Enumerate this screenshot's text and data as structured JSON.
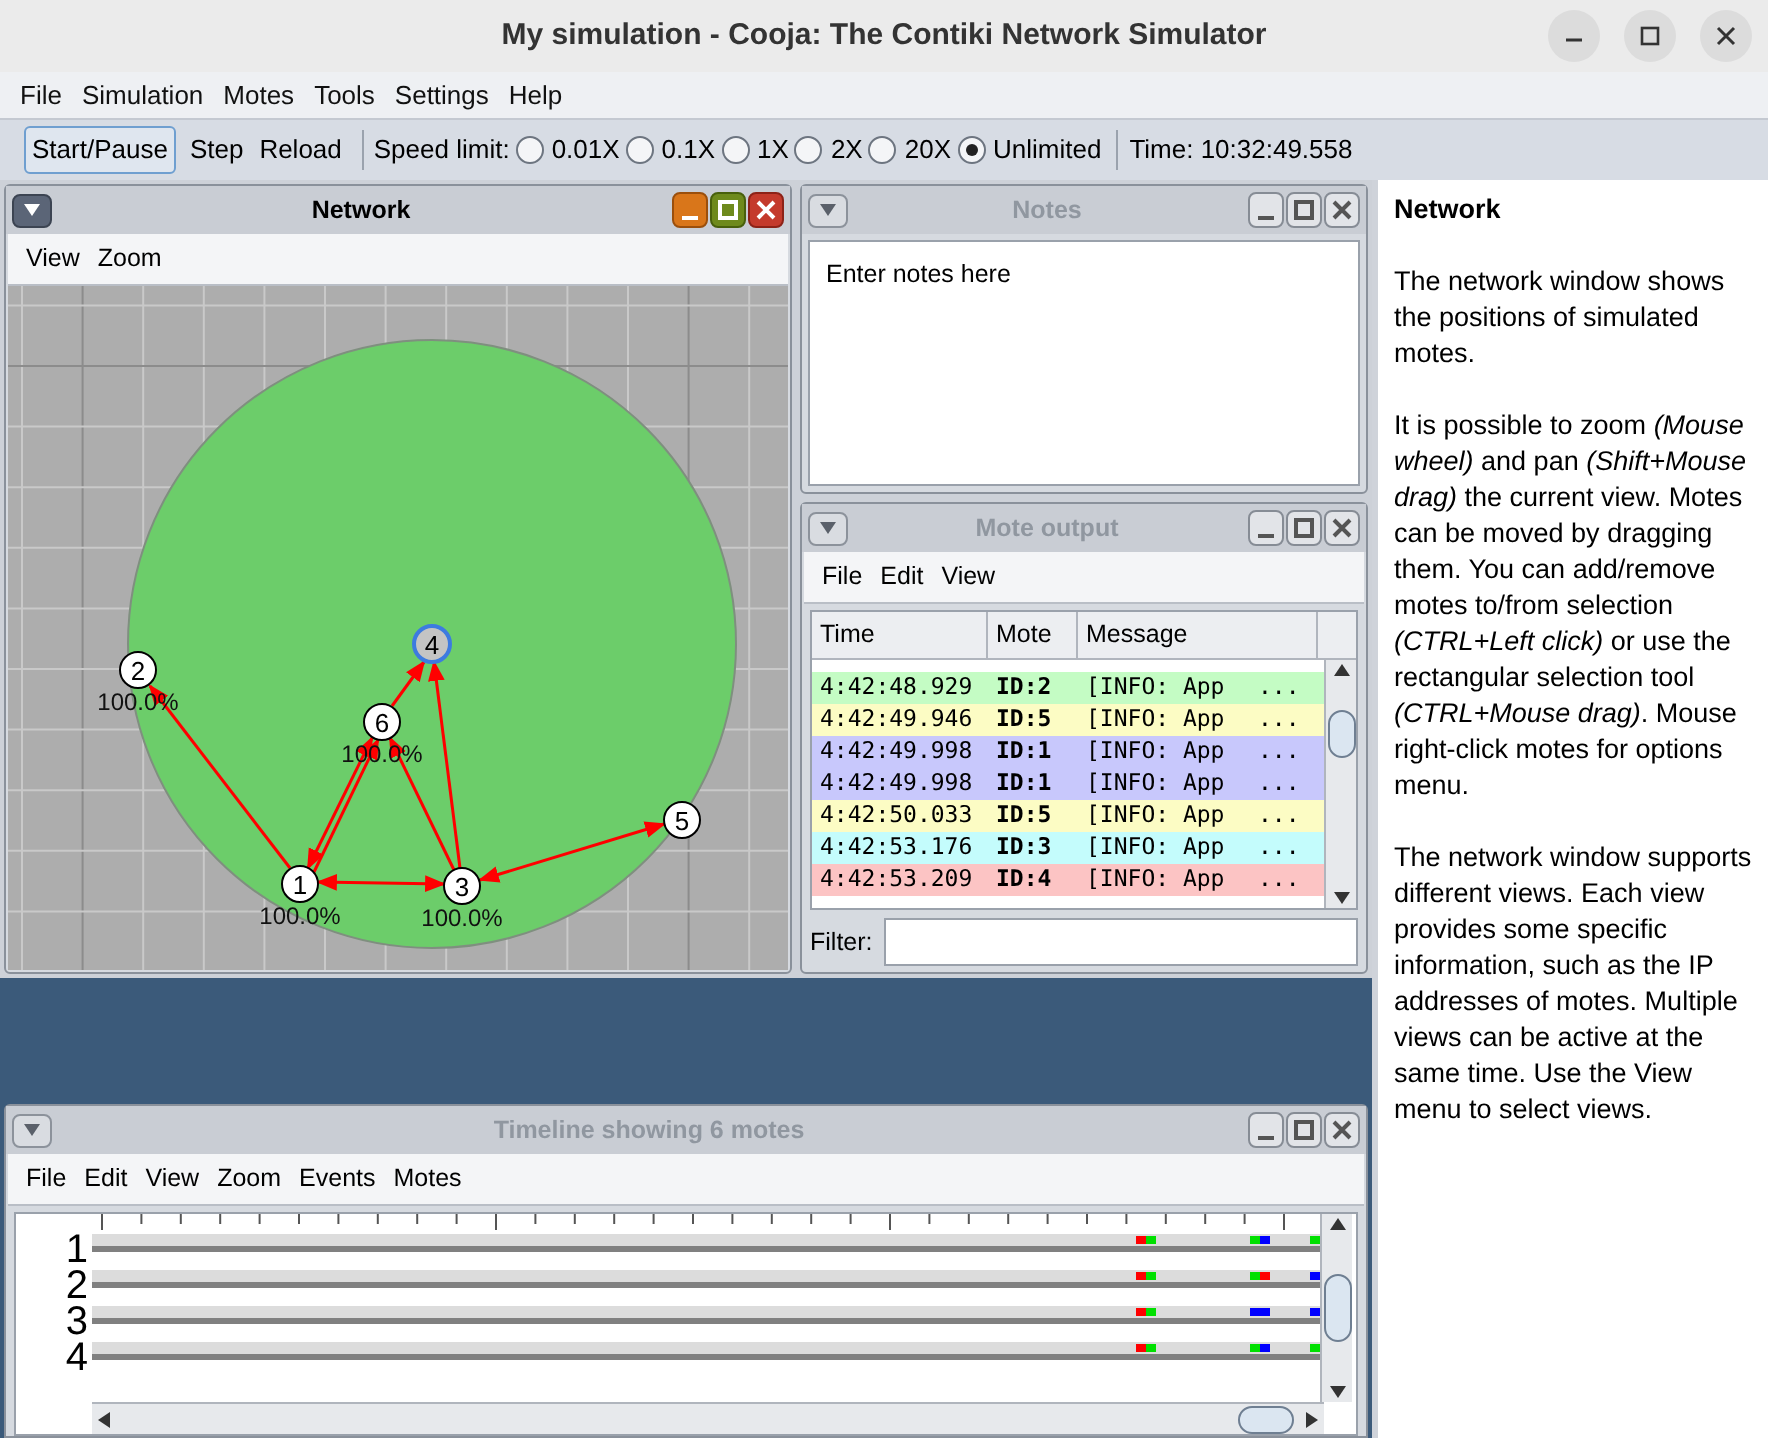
{
  "window": {
    "title": "My simulation - Cooja: The Contiki Network Simulator"
  },
  "menu": [
    "File",
    "Simulation",
    "Motes",
    "Tools",
    "Settings",
    "Help"
  ],
  "toolbar": {
    "buttons": [
      {
        "label": "Start/Pause",
        "focused": true
      },
      {
        "label": "Step",
        "focused": false
      },
      {
        "label": "Reload",
        "focused": false
      }
    ],
    "speed_label": "Speed limit:",
    "speeds": [
      {
        "label": "0.01X",
        "selected": false
      },
      {
        "label": "0.1X",
        "selected": false
      },
      {
        "label": "1X",
        "selected": false
      },
      {
        "label": "2X",
        "selected": false
      },
      {
        "label": "20X",
        "selected": false
      },
      {
        "label": "Unlimited",
        "selected": true
      }
    ],
    "time": "Time: 10:32:49.558"
  },
  "network": {
    "title": "Network",
    "active": true,
    "menu": [
      "View",
      "Zoom"
    ],
    "motes": [
      {
        "id": "4",
        "selected": true
      },
      {
        "id": "2",
        "reading": "100.0%",
        "selected": false
      },
      {
        "id": "6",
        "reading": "100.0%",
        "selected": false
      },
      {
        "id": "5",
        "selected": false
      },
      {
        "id": "1",
        "reading": "100.0%",
        "selected": false
      },
      {
        "id": "3",
        "reading": "100.0%",
        "selected": false
      }
    ]
  },
  "notes": {
    "title": "Notes",
    "active": false,
    "text": "Enter notes here"
  },
  "mote_output": {
    "title": "Mote output",
    "active": false,
    "menu": [
      "File",
      "Edit",
      "View"
    ],
    "columns": [
      "Time",
      "Mote",
      "Message"
    ],
    "rows": [
      {
        "time": "4:42:48.929",
        "mote": "ID:2",
        "message": "[INFO: App",
        "more": "...",
        "color": "#c4fcc4"
      },
      {
        "time": "4:42:49.946",
        "mote": "ID:5",
        "message": "[INFO: App",
        "more": "...",
        "color": "#fcfcc4"
      },
      {
        "time": "4:42:49.998",
        "mote": "ID:1",
        "message": "[INFO: App",
        "more": "...",
        "color": "#c8c8fc"
      },
      {
        "time": "4:42:49.998",
        "mote": "ID:1",
        "message": "[INFO: App",
        "more": "...",
        "color": "#c8c8fc"
      },
      {
        "time": "4:42:50.033",
        "mote": "ID:5",
        "message": "[INFO: App",
        "more": "...",
        "color": "#fcfcc4"
      },
      {
        "time": "4:42:53.176",
        "mote": "ID:3",
        "message": "[INFO: App",
        "more": "...",
        "color": "#c4fcfc"
      },
      {
        "time": "4:42:53.209",
        "mote": "ID:4",
        "message": "[INFO: App",
        "more": "...",
        "color": "#fcc4c4"
      }
    ],
    "filter_label": "Filter:"
  },
  "timeline": {
    "title": "Timeline showing 6 motes",
    "active": false,
    "menu": [
      "File",
      "Edit",
      "View",
      "Zoom",
      "Events",
      "Motes"
    ],
    "rows": [
      "1",
      "2",
      "3",
      "4"
    ]
  },
  "help": {
    "title": "Network",
    "paragraphs": [
      "The network window shows the positions of simulated motes.",
      "It is possible to zoom *(Mouse wheel)* and pan *(Shift+Mouse drag)* the current view. Motes can be moved by dragging them. You can add/remove motes to/from selection *(CTRL+Left click)* or use the rectangular selection tool *(CTRL+Mouse drag)*. Mouse right-click motes for options menu.",
      "The network window supports different views. Each view provides some specific information, such as the IP addresses of motes. Multiple views can be active at the same time. Use the View menu to select views."
    ]
  }
}
